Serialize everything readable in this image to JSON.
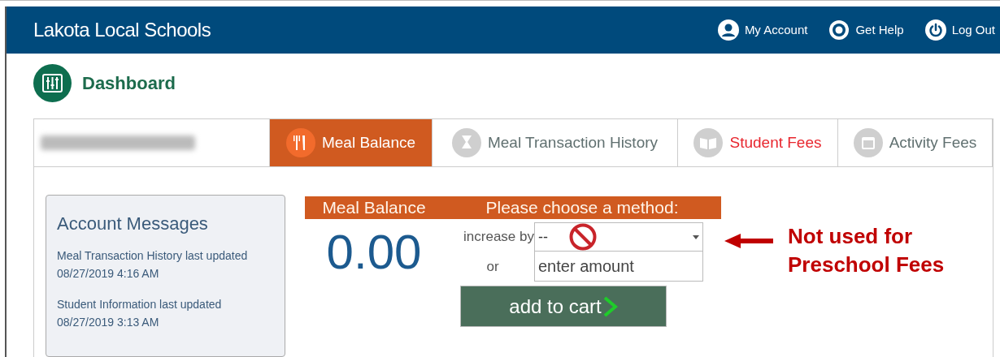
{
  "header": {
    "title": "Lakota Local Schools",
    "links": [
      {
        "kind": "account",
        "label": "My Account"
      },
      {
        "kind": "help",
        "label": "Get Help"
      },
      {
        "kind": "logout",
        "label": "Log Out"
      }
    ]
  },
  "page": {
    "title": "Dashboard"
  },
  "tabs": [
    {
      "kind": "name",
      "selected": false
    },
    {
      "kind": "meal",
      "label": "Meal Balance",
      "selected": true,
      "alert": false
    },
    {
      "kind": "history",
      "label": "Meal Transaction History",
      "selected": false,
      "alert": false
    },
    {
      "kind": "fees",
      "label": "Student Fees",
      "selected": false,
      "alert": true
    },
    {
      "kind": "activity",
      "label": "Activity Fees",
      "selected": false,
      "alert": false
    }
  ],
  "messages": {
    "title": "Account Messages",
    "items": [
      "Meal Transaction History last updated 08/27/2019 4:16 AM",
      "Student Information last updated 08/27/2019 3:13 AM"
    ]
  },
  "balance": {
    "title": "Meal Balance",
    "amount": "0.00"
  },
  "method": {
    "title": "Please choose a method:",
    "increase_label": "increase by",
    "select_value": "--",
    "or_label": "or",
    "amount_placeholder": "enter amount",
    "button": "add to cart"
  },
  "annotation": {
    "text": "Not used for Preschool Fees"
  }
}
